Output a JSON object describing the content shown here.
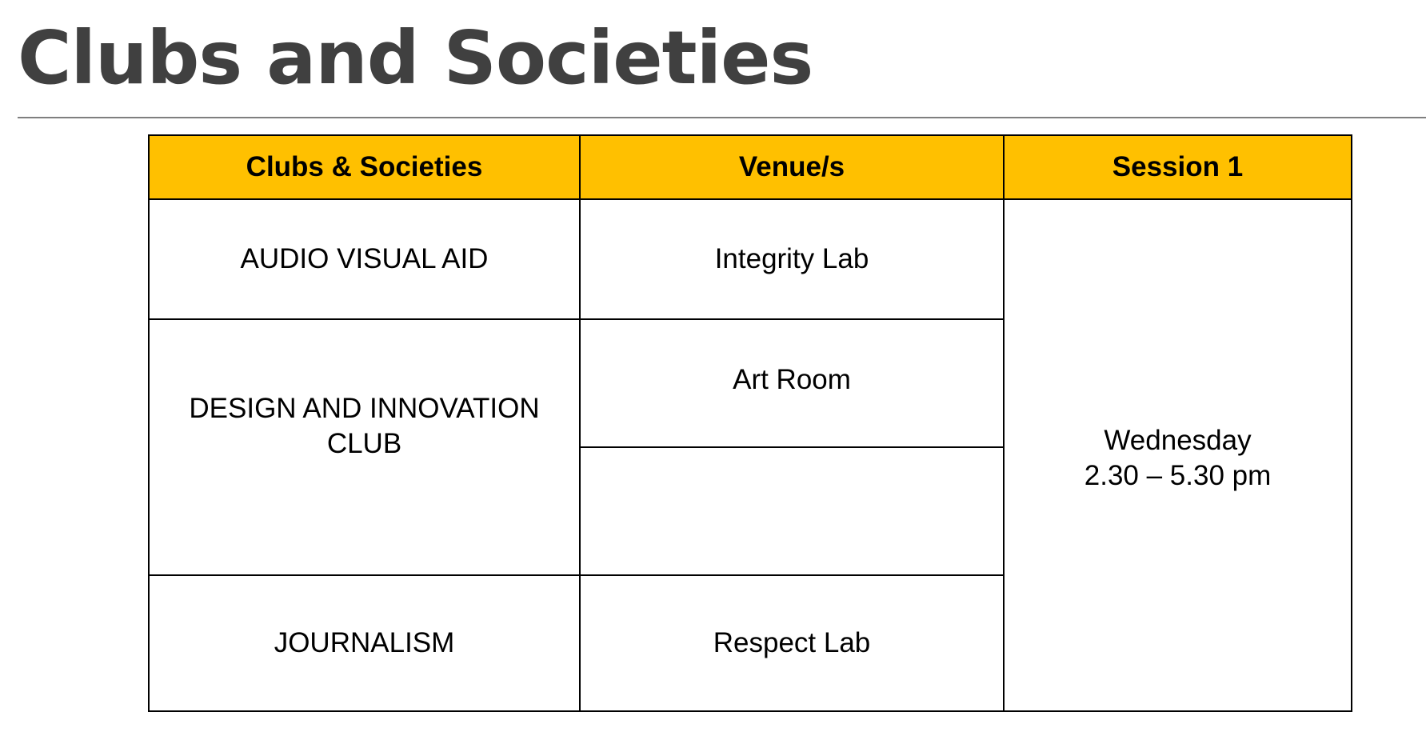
{
  "page": {
    "title": "Clubs and Societies"
  },
  "table": {
    "headers": {
      "clubs": "Clubs & Societies",
      "venues": "Venue/s",
      "session": "Session 1"
    },
    "rows": [
      {
        "club": "AUDIO VISUAL AID",
        "venue": "Integrity Lab"
      },
      {
        "club": "DESIGN AND INNOVATION CLUB",
        "venue": "Art Room",
        "venue_extra": ""
      },
      {
        "club": "JOURNALISM",
        "venue": "Respect Lab"
      }
    ],
    "session": {
      "day": "Wednesday",
      "time": "2.30 – 5.30 pm"
    }
  },
  "colors": {
    "header_fill": "#ffc000",
    "title_text": "#404040",
    "rule": "#7f7f7f"
  }
}
